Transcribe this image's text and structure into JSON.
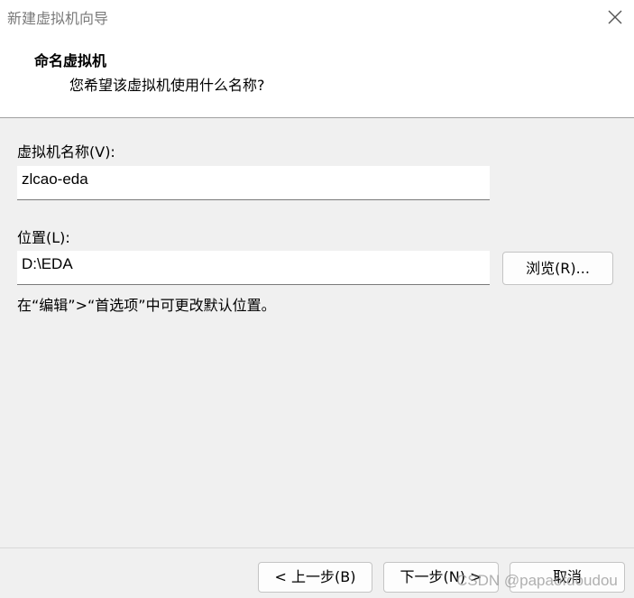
{
  "window": {
    "title": "新建虚拟机向导",
    "close_icon": "close-icon"
  },
  "header": {
    "title": "命名虚拟机",
    "subtitle": "您希望该虚拟机使用什么名称?"
  },
  "name_field": {
    "label": "虚拟机名称(V):",
    "value": "zlcao-eda"
  },
  "location_field": {
    "label": "位置(L):",
    "value": "D:\\EDA",
    "browse_label": "浏览(R)..."
  },
  "note": "在“编辑”>“首选项”中可更改默认位置。",
  "footer": {
    "back_label": "< 上一步(B)",
    "next_label": "下一步(N) >",
    "cancel_label": "取消"
  },
  "watermark": "CSDN @papaofdoudou"
}
